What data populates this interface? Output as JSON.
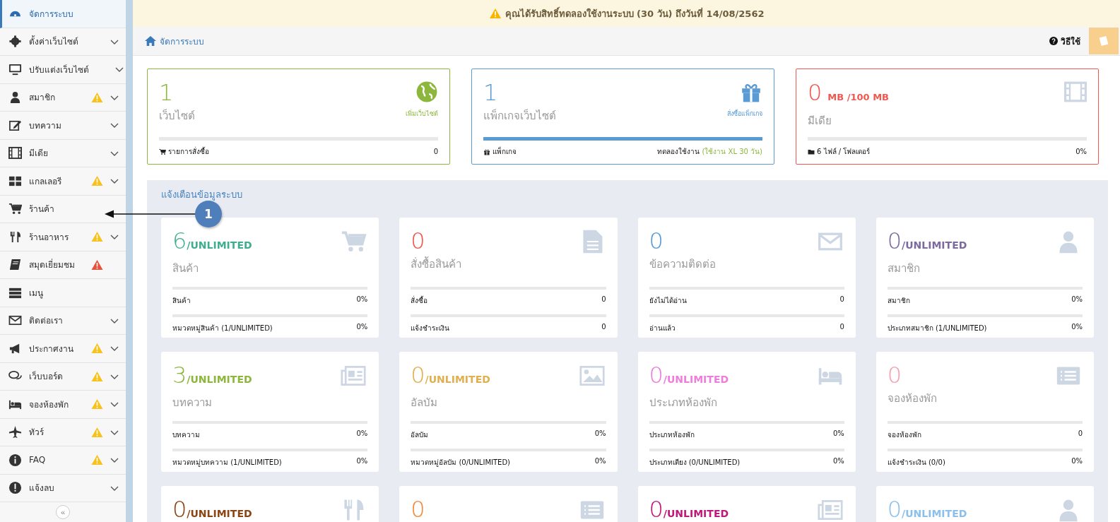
{
  "sidebar": {
    "items": [
      {
        "label": "จัดการระบบ",
        "selected": true,
        "expandable": false
      },
      {
        "label": "ตั้งค่าเว็บไซต์",
        "selected": false,
        "expandable": true
      },
      {
        "label": "ปรับแต่งเว็บไซต์",
        "selected": false,
        "expandable": true
      },
      {
        "label": "สมาชิก",
        "selected": false,
        "color": "#f7c21b",
        "expandable": true
      },
      {
        "label": "บทความ",
        "selected": false,
        "expandable": true
      },
      {
        "label": "มีเดีย",
        "selected": false,
        "expandable": true
      },
      {
        "label": "แกลเลอรี",
        "selected": false,
        "color": "#f7c21b",
        "expandable": true
      },
      {
        "label": "ร้านค้า",
        "selected": false,
        "expandable": false
      },
      {
        "label": "ร้านอาหาร",
        "selected": false,
        "color": "#f7c21b",
        "expandable": true
      },
      {
        "label": "สมุดเยี่ยมชม",
        "selected": false,
        "color": "#e5533d",
        "expandable": false
      },
      {
        "label": "เมนู",
        "selected": false,
        "expandable": false
      },
      {
        "label": "ติดต่อเรา",
        "selected": false,
        "expandable": true
      },
      {
        "label": "ประกาศงาน",
        "selected": false,
        "color": "#f7c21b",
        "expandable": true
      },
      {
        "label": "เว็บบอร์ด",
        "selected": false,
        "color": "#f7c21b",
        "expandable": true
      },
      {
        "label": "จองห้องพัก",
        "selected": false,
        "color": "#f7c21b",
        "expandable": true
      },
      {
        "label": "ทัวร์",
        "selected": false,
        "color": "#f7c21b",
        "expandable": true
      },
      {
        "label": "FAQ",
        "selected": false,
        "color": "#f7c21b",
        "expandable": true
      },
      {
        "label": "แจ้งลบ",
        "selected": false,
        "expandable": true
      }
    ],
    "collapse": "«"
  },
  "notice": "คุณได้รับสิทธิ์ทดลองใช้งานระบบ (30 วัน) ถึงวันที่ 14/08/2562",
  "breadcrumb": "จัดการระบบ",
  "help": "วิธีใช้",
  "summary_cards": [
    {
      "color": "#8cb63c",
      "value": "1",
      "title": "เว็บไซต์",
      "action": "เพิ่มเว็บไซต์",
      "footer_label": "รายการสั่งซื้อ",
      "footer_value": "0"
    },
    {
      "color": "#5b9bd5",
      "value": "1",
      "title": "แพ็กเกจเว็บไซต์",
      "action": "สั่งซื้อแพ็กเกจ",
      "level": 1,
      "footer_label": "แพ็กเกจ",
      "footer_value": "ทดลองใช้งาน",
      "footer_note": "(ใช้งาน XL 30 วัน)"
    },
    {
      "color": "#f0584f",
      "value": "0",
      "unit": "MB  /100 MB",
      "title": "มีเดีย",
      "footer_label": "6 ไฟล์ / โฟลเดอร์",
      "footer_value": "0%"
    }
  ],
  "alerts": {
    "title": "แจ้งเตือนข้อมูลระบบ",
    "cards": [
      {
        "color": "#3fae8f",
        "value": "6",
        "unit": "/UNLIMITED",
        "title": "สินค้า",
        "rows": [
          {
            "label": "สินค้า",
            "value": "0%"
          },
          {
            "label": "หมวดหมู่สินค้า",
            "note": "(1/UNLIMITED)",
            "value": "0%"
          }
        ]
      },
      {
        "color": "#f0584f",
        "value": "0",
        "title": "สั่งซื้อสินค้า",
        "rows": [
          {
            "label": "สั่งซื้อ",
            "value": "0"
          },
          {
            "label": "แจ้งชำระเงิน",
            "value": "0"
          }
        ]
      },
      {
        "color": "#5b9bd5",
        "value": "0",
        "title": "ข้อความติดต่อ",
        "rows": [
          {
            "label": "ยังไม่ได้อ่าน",
            "value": "0"
          },
          {
            "label": "อ่านแล้ว",
            "value": "0"
          }
        ]
      },
      {
        "color": "#7d6b9e",
        "value": "0",
        "unit": "/UNLIMITED",
        "title": "สมาชิก",
        "rows": [
          {
            "label": "สมาชิก",
            "value": "0%"
          },
          {
            "label": "ประเภทสมาชิก",
            "note": "(1/UNLIMITED)",
            "value": "0%"
          }
        ]
      },
      {
        "color": "#8cb63c",
        "value": "3",
        "unit": "/UNLIMITED",
        "title": "บทความ",
        "rows": [
          {
            "label": "บทความ",
            "value": "0%"
          },
          {
            "label": "หมวดหมู่บทความ",
            "note": "(1/UNLIMITED)",
            "value": "0%"
          }
        ]
      },
      {
        "color": "#e0b050",
        "value": "0",
        "unit": "/UNLIMITED",
        "title": "อัลบัม",
        "rows": [
          {
            "label": "อัลบัม",
            "value": "0%"
          },
          {
            "label": "หมวดหมู่อัลบัม",
            "note": "(0/UNLIMITED)",
            "value": "0%"
          }
        ]
      },
      {
        "color": "#ee7ddc",
        "value": "0",
        "unit": "/UNLIMITED",
        "title": "ประเภทห้องพัก",
        "rows": [
          {
            "label": "ประเภทห้องพัก",
            "value": "0%"
          },
          {
            "label": "ประเภทเตียง",
            "note": "(0/UNLIMITED)",
            "value": "0%"
          }
        ]
      },
      {
        "color": "#f7a1b0",
        "value": "0",
        "title": "จองห้องพัก",
        "rows": [
          {
            "label": "จองห้องพัก",
            "value": "0"
          },
          {
            "label": "แจ้งชำระเงิน",
            "note": "(0/0)",
            "value": "0%"
          }
        ]
      },
      {
        "color": "#8b4513",
        "value": "0",
        "unit": "/UNLIMITED"
      },
      {
        "color": "#f08a3c",
        "value": "0"
      },
      {
        "color": "#c0187a",
        "value": "0",
        "unit": "/UNLIMITED"
      },
      {
        "color": "#8cc0ea",
        "value": "0",
        "unit": "/UNLIMITED"
      }
    ]
  },
  "annotation": {
    "label": "1"
  }
}
